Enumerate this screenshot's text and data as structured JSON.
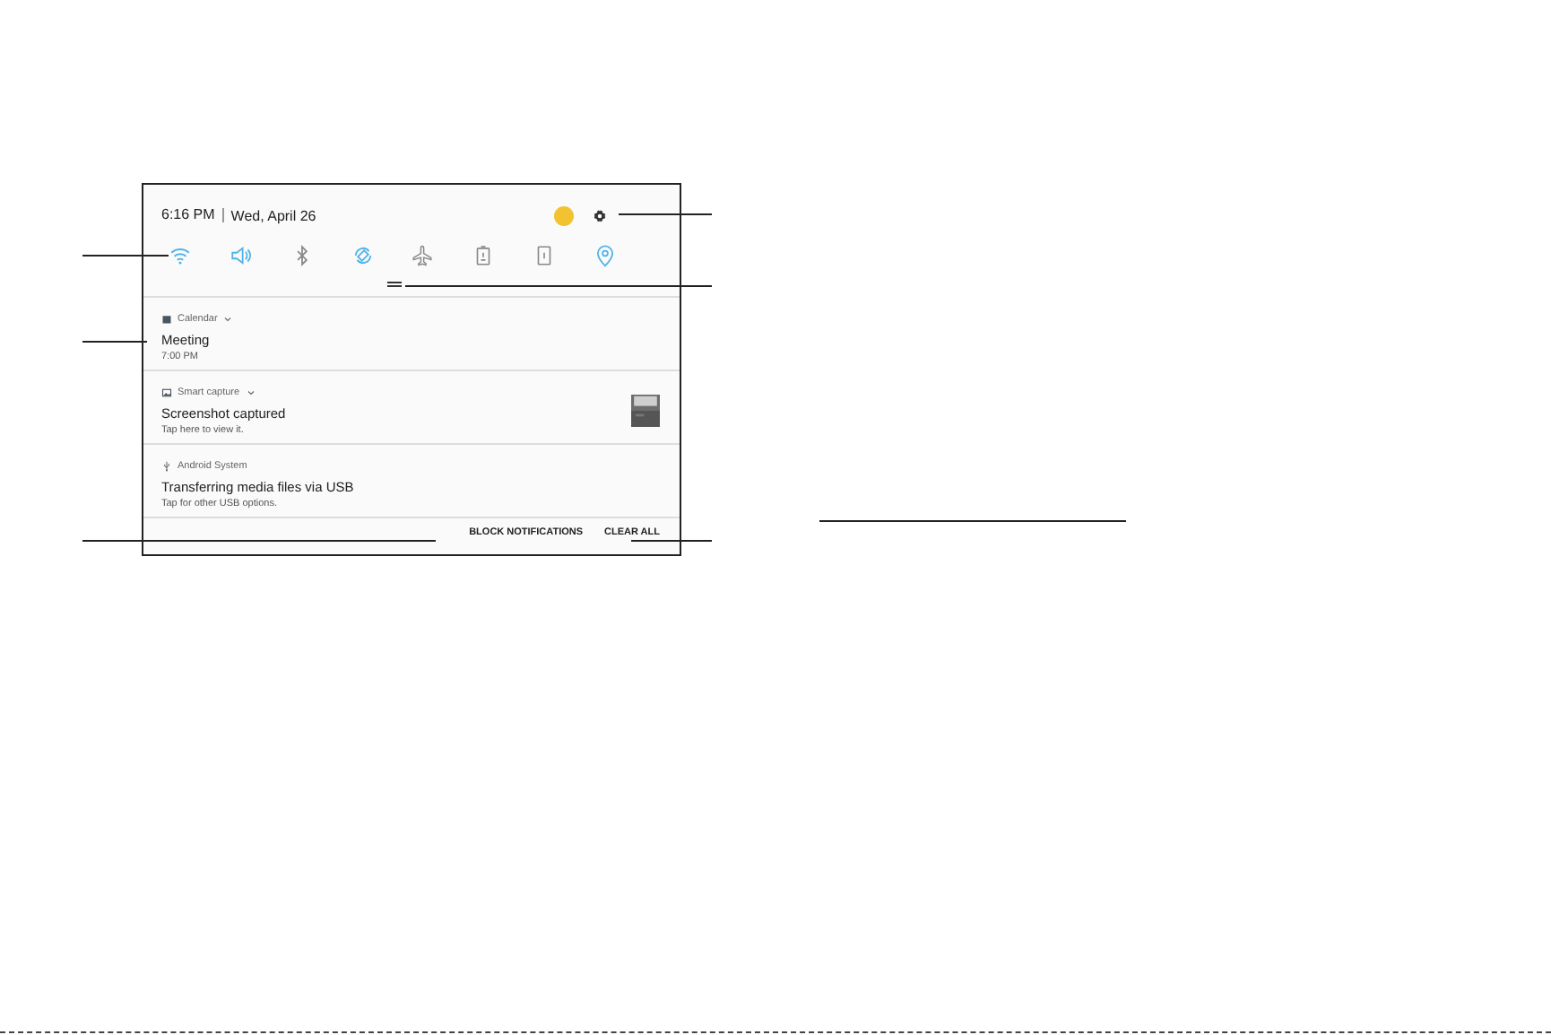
{
  "status_bar": {
    "time": "6:16 PM",
    "date": "Wed, April 26"
  },
  "quick_settings": [
    {
      "kind": "wifi",
      "on": true
    },
    {
      "kind": "sound",
      "on": true
    },
    {
      "kind": "bluetooth",
      "on": false
    },
    {
      "kind": "rotate",
      "on": true
    },
    {
      "kind": "airplane",
      "on": false
    },
    {
      "kind": "battery",
      "on": false
    },
    {
      "kind": "flashlight",
      "on": false
    },
    {
      "kind": "location",
      "on": true
    }
  ],
  "notifications": [
    {
      "kind": "calendar",
      "app": "Calendar",
      "expandable": true,
      "title": "Meeting",
      "text": "7:00 PM",
      "thumbnail": false
    },
    {
      "kind": "capture",
      "app": "Smart capture",
      "expandable": true,
      "title": "Screenshot captured",
      "text": "Tap here to view it.",
      "thumbnail": true
    },
    {
      "kind": "usb",
      "app": "Android System",
      "expandable": false,
      "title": "Transferring media files via USB",
      "text": "Tap for other USB options.",
      "thumbnail": false
    }
  ],
  "actions": [
    "BLOCK NOTIFICATIONS",
    "CLEAR ALL"
  ]
}
